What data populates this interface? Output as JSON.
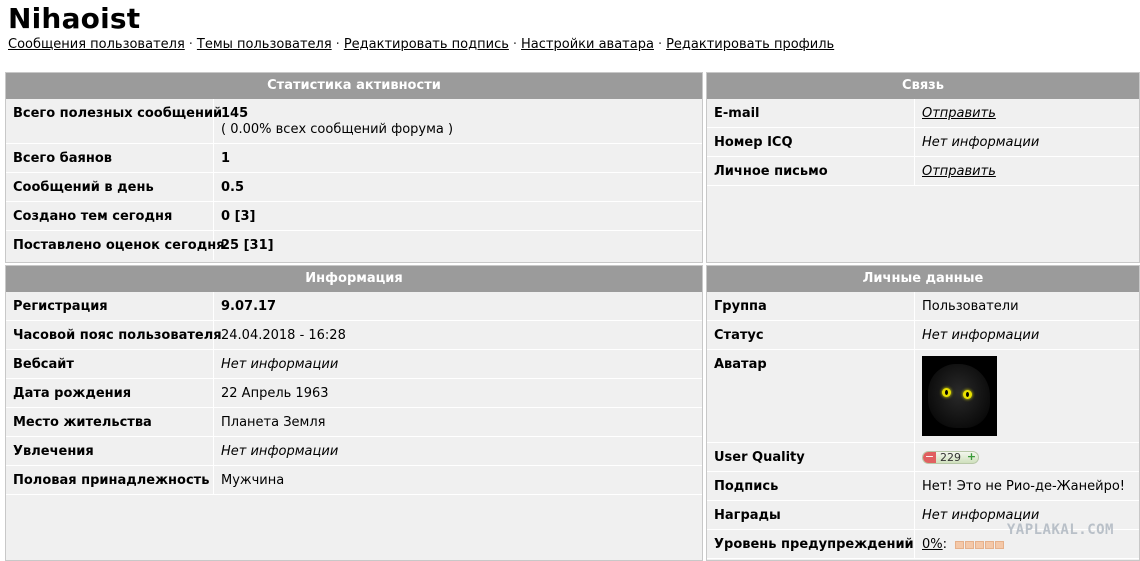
{
  "profile": {
    "username": "Nihaoist",
    "links": [
      "Сообщения пользователя",
      "Темы пользователя",
      "Редактировать подпись",
      "Настройки аватара",
      "Редактировать профиль"
    ],
    "separator": "·"
  },
  "activity": {
    "title": "Статистика активности",
    "rows": [
      {
        "label": "Всего полезных сообщений",
        "value": "145",
        "sub": "( 0.00% всех сообщений форума )"
      },
      {
        "label": "Всего баянов",
        "value": "1"
      },
      {
        "label": "Сообщений в день",
        "value": "0.5"
      },
      {
        "label": "Создано тем сегодня",
        "value": "0 [3]"
      },
      {
        "label": "Поставлено оценок сегодня",
        "value": "25 [31]"
      }
    ]
  },
  "contact": {
    "title": "Связь",
    "rows": [
      {
        "label": "E-mail",
        "value": "Отправить"
      },
      {
        "label": "Номер ICQ",
        "value": "Нет информации"
      },
      {
        "label": "Личное письмо",
        "value": "Отправить"
      }
    ]
  },
  "info": {
    "title": "Информация",
    "rows": [
      {
        "label": "Регистрация",
        "value": "9.07.17"
      },
      {
        "label": "Часовой пояс пользователя",
        "value": "24.04.2018 - 16:28"
      },
      {
        "label": "Вебсайт",
        "value": "Нет информации"
      },
      {
        "label": "Дата рождения",
        "value": "22 Апрель 1963"
      },
      {
        "label": "Место жительства",
        "value": "Планета Земля"
      },
      {
        "label": "Увлечения",
        "value": "Нет информации"
      },
      {
        "label": "Половая принадлежность",
        "value": "Мужчина"
      }
    ]
  },
  "personal": {
    "title": "Личные данные",
    "rows": [
      {
        "label": "Группа",
        "value": "Пользователи"
      },
      {
        "label": "Статус",
        "value": "Нет информации"
      },
      {
        "label": "Аватар",
        "value": ""
      },
      {
        "label": "User Quality",
        "value": "229",
        "minus": "−",
        "plus": "+"
      },
      {
        "label": "Подпись",
        "value": "Нет! Это не Рио-де-Жанейро!"
      },
      {
        "label": "Награды",
        "value": "Нет информации"
      },
      {
        "label": "Уровень предупреждений",
        "value": "0%",
        "suffix": ":"
      }
    ]
  },
  "watermark": "YAPLAKAL.COM"
}
